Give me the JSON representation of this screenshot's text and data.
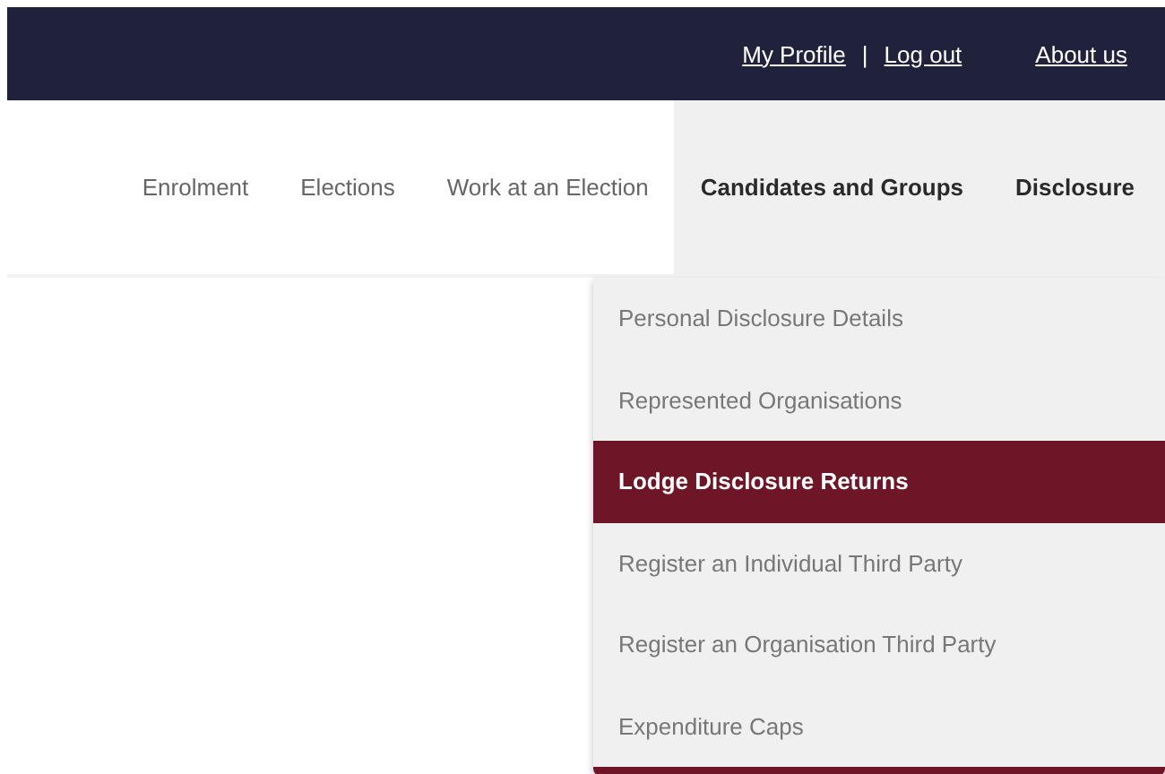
{
  "top_links": [
    {
      "label": "My Profile"
    },
    {
      "label": "|"
    },
    {
      "label": "Log out"
    },
    {
      "label": "About us"
    }
  ],
  "nav": [
    {
      "label": "Enrolment",
      "active": false
    },
    {
      "label": "Elections",
      "active": false
    },
    {
      "label": "Work at an Election",
      "active": false
    },
    {
      "label": "Candidates and Groups",
      "active": true
    },
    {
      "label": "Disclosure",
      "active": true
    }
  ],
  "dropdown": [
    {
      "label": "Personal Disclosure Details",
      "selected": false
    },
    {
      "label": "Represented Organisations",
      "selected": false
    },
    {
      "label": "Lodge Disclosure Returns",
      "selected": true
    },
    {
      "label": "Register an Individual Third Party",
      "selected": false
    },
    {
      "label": "Register an Organisation Third Party",
      "selected": false
    },
    {
      "label": "Expenditure Caps",
      "selected": false
    }
  ]
}
